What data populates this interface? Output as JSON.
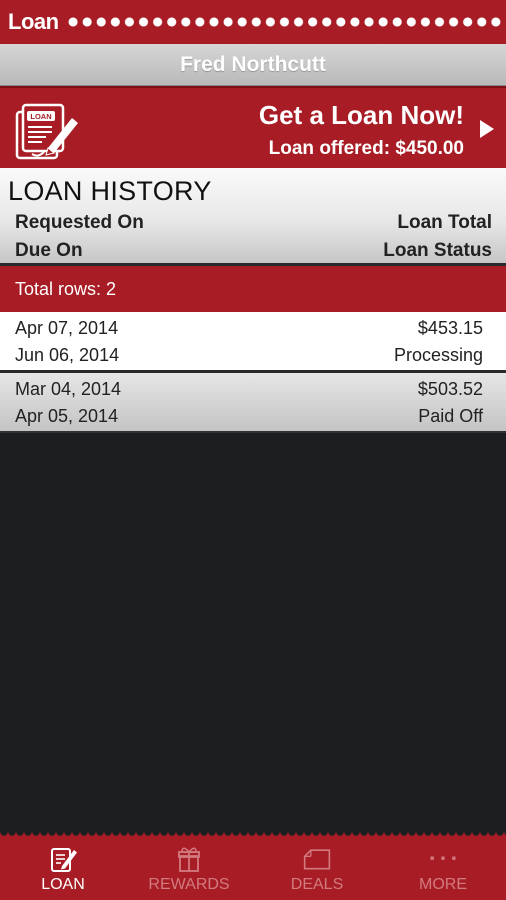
{
  "app": {
    "title": "Loan"
  },
  "user": {
    "name": "Fred Northcutt"
  },
  "banner": {
    "icon_text": "LOAN",
    "headline": "Get a Loan Now!",
    "offer": "Loan offered: $450.00"
  },
  "history": {
    "title": "LOAN HISTORY",
    "columns": {
      "requested_on": "Requested On",
      "loan_total": "Loan Total",
      "due_on": "Due On",
      "loan_status": "Loan Status"
    },
    "total_rows_label": "Total rows: 2",
    "rows": [
      {
        "requested_on": "Apr 07, 2014",
        "due_on": "Jun 06, 2014",
        "loan_total": "$453.15",
        "loan_status": "Processing"
      },
      {
        "requested_on": "Mar 04, 2014",
        "due_on": "Apr 05, 2014",
        "loan_total": "$503.52",
        "loan_status": "Paid Off"
      }
    ]
  },
  "nav": {
    "items": [
      {
        "label": "LOAN",
        "icon": "loan-icon",
        "active": true
      },
      {
        "label": "REWARDS",
        "icon": "gift-icon",
        "active": false
      },
      {
        "label": "DEALS",
        "icon": "tag-icon",
        "active": false
      },
      {
        "label": "MORE",
        "icon": "more-dots-icon",
        "active": false
      }
    ]
  },
  "colors": {
    "brand": "#a81d25",
    "background": "#1c1e20",
    "inactive_nav": "#d27a7f"
  }
}
